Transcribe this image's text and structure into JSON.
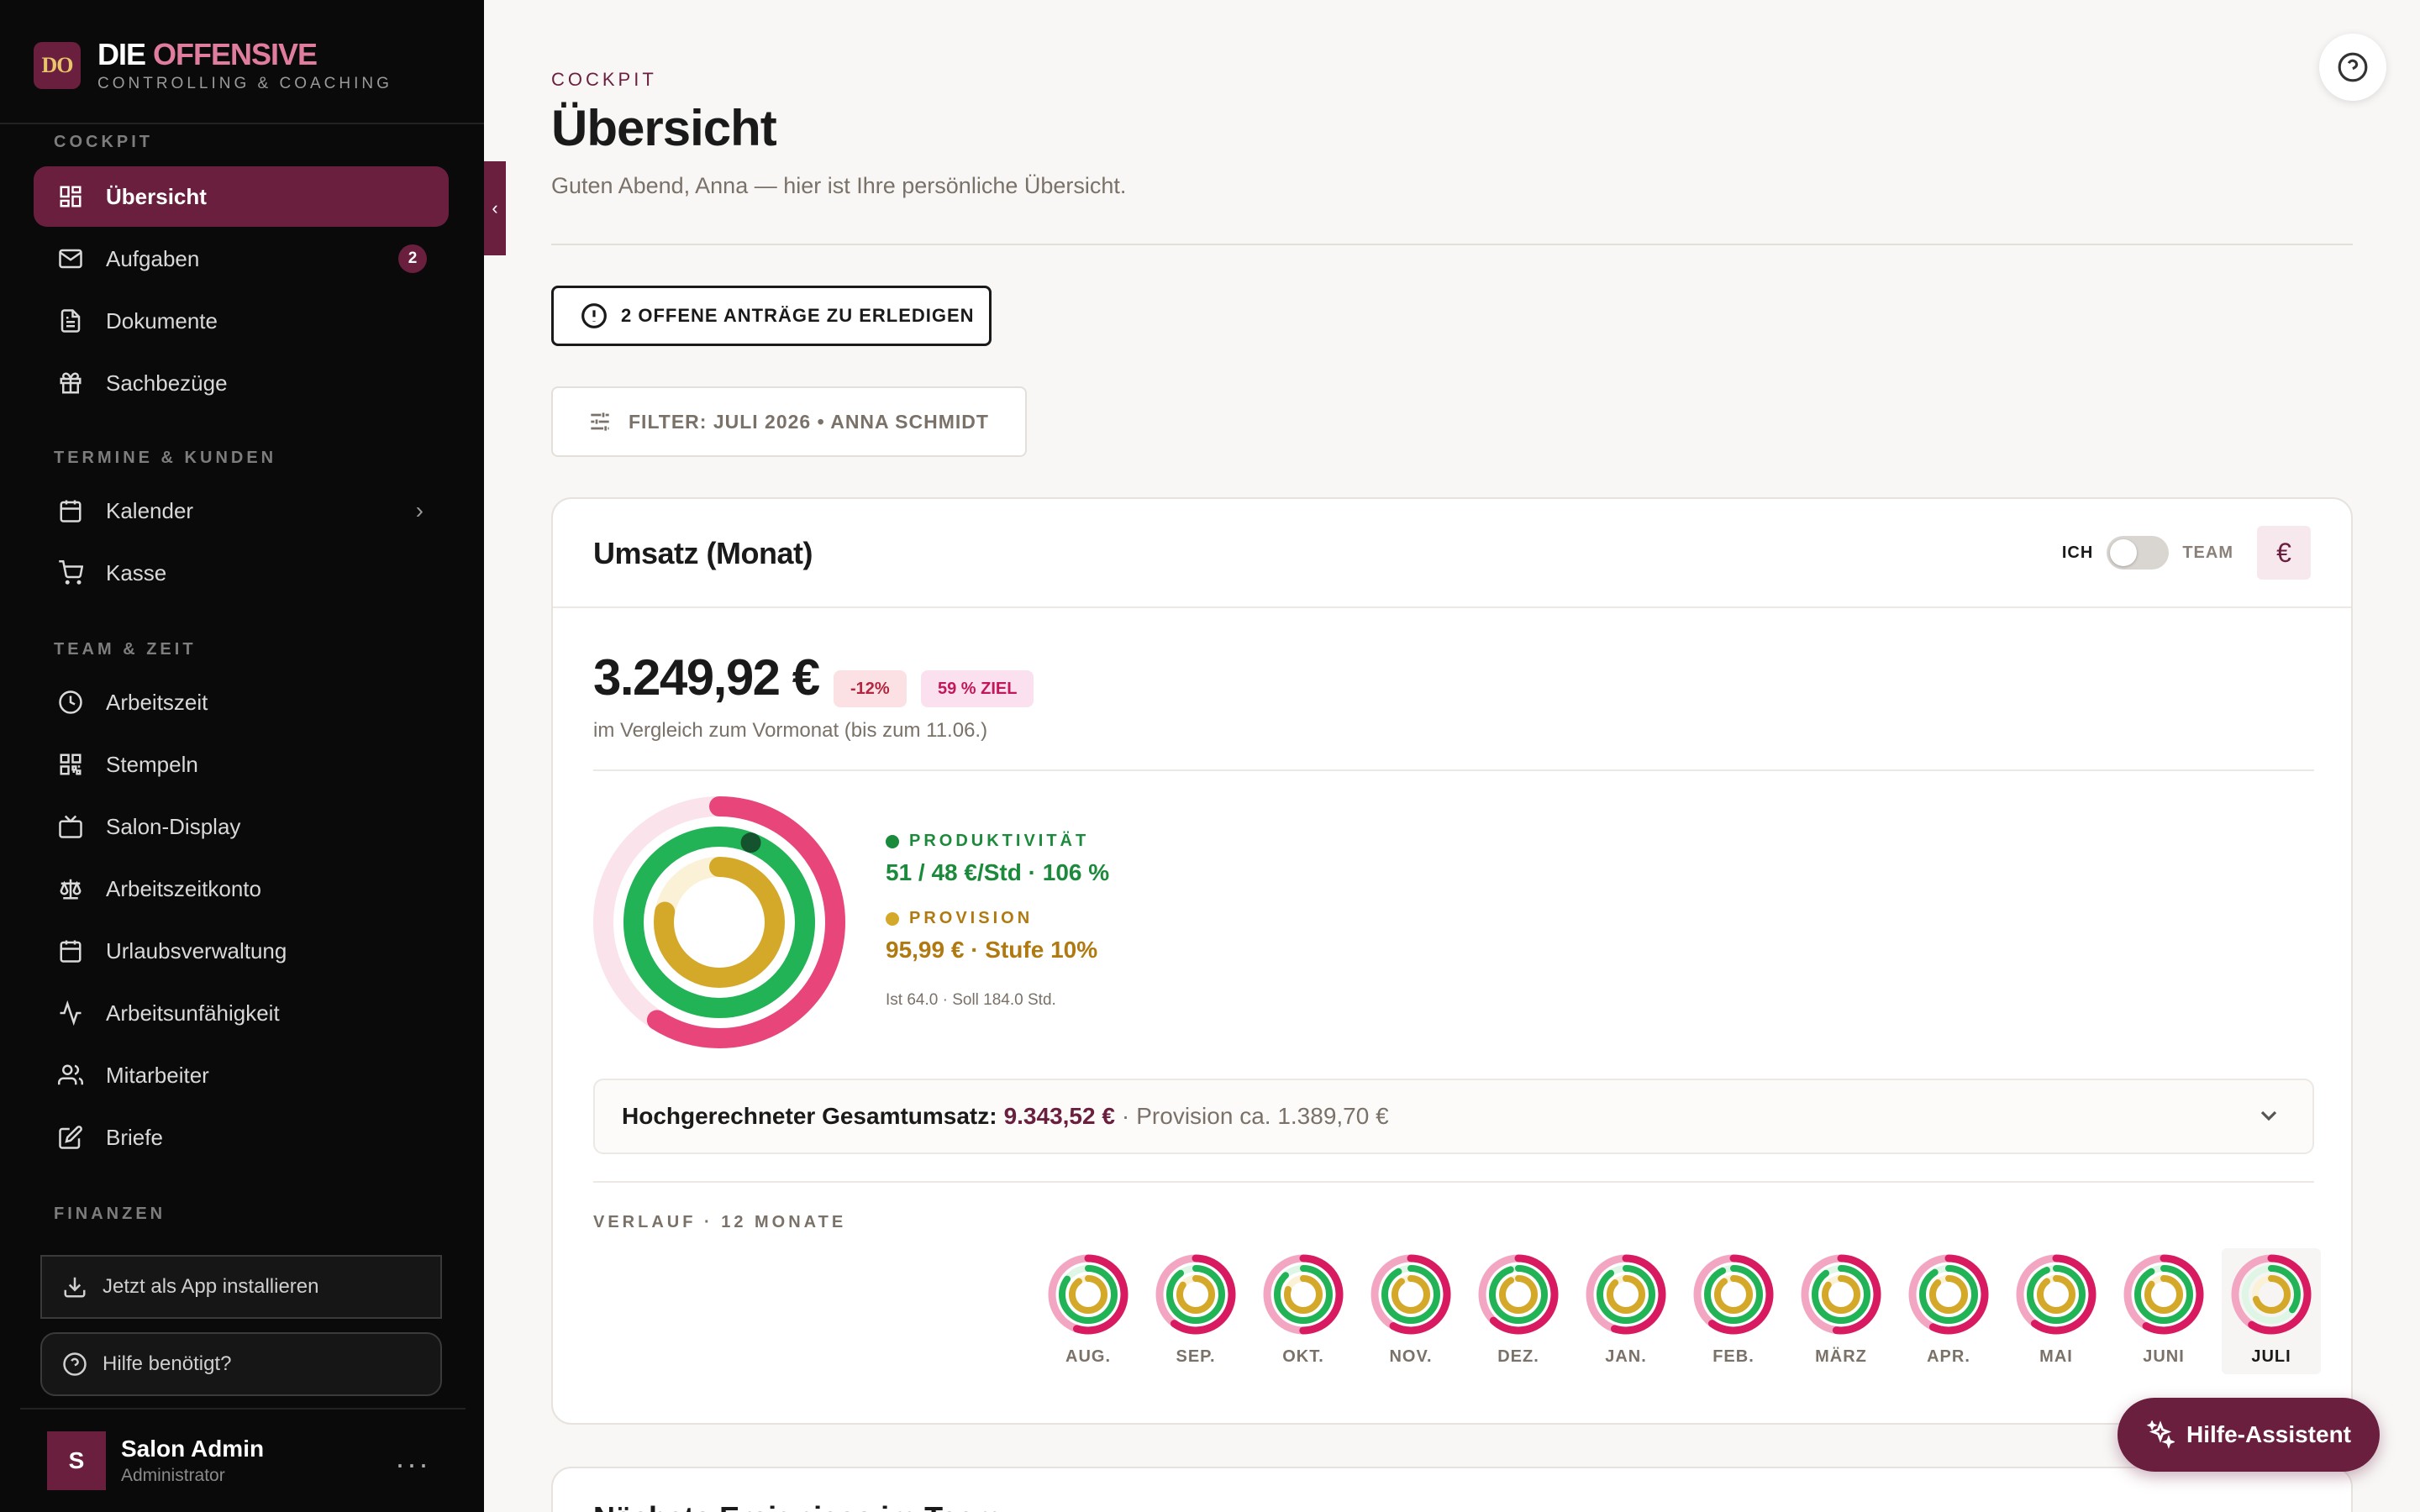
{
  "brand": {
    "logo_text": "DO",
    "title_part1": "DIE",
    "title_part2": "OFFENSIVE",
    "subtitle": "CONTROLLING & COACHING",
    "accent_color": "#6b1f3f"
  },
  "sidebar": {
    "sections": [
      {
        "label": "COCKPIT"
      },
      {
        "label": "TERMINE & KUNDEN"
      },
      {
        "label": "TEAM & ZEIT"
      },
      {
        "label": "FINANZEN"
      }
    ],
    "items": [
      {
        "label": "Übersicht",
        "icon": "dashboard-icon",
        "active": true
      },
      {
        "label": "Aufgaben",
        "icon": "mail-icon",
        "badge": "2"
      },
      {
        "label": "Dokumente",
        "icon": "document-icon"
      },
      {
        "label": "Sachbezüge",
        "icon": "gift-icon"
      },
      {
        "label": "Kalender",
        "icon": "calendar-icon",
        "expandable": true
      },
      {
        "label": "Kasse",
        "icon": "cart-icon"
      },
      {
        "label": "Arbeitszeit",
        "icon": "clock-icon"
      },
      {
        "label": "Stempeln",
        "icon": "qr-icon"
      },
      {
        "label": "Salon-Display",
        "icon": "tv-icon"
      },
      {
        "label": "Arbeitszeitkonto",
        "icon": "scale-icon"
      },
      {
        "label": "Urlaubsverwaltung",
        "icon": "calendar-icon"
      },
      {
        "label": "Arbeitsunfähigkeit",
        "icon": "activity-icon"
      },
      {
        "label": "Mitarbeiter",
        "icon": "users-icon"
      },
      {
        "label": "Briefe",
        "icon": "edit-icon"
      }
    ],
    "install_label": "Jetzt als App installieren",
    "help_label": "Hilfe benötigt?",
    "user": {
      "initial": "S",
      "name": "Salon Admin",
      "role": "Administrator"
    }
  },
  "header": {
    "eyebrow": "COCKPIT",
    "title": "Übersicht",
    "subtitle": "Guten Abend, Anna — hier ist Ihre persönliche Übersicht."
  },
  "pending": {
    "label": "2 OFFENE ANTRÄGE ZU ERLEDIGEN"
  },
  "filter": {
    "label": "FILTER: JULI 2026 • ANNA SCHMIDT"
  },
  "revenue_card": {
    "title": "Umsatz (Monat)",
    "toggle_left": "ICH",
    "toggle_right": "TEAM",
    "currency_symbol": "€",
    "amount": "3.249,92 €",
    "change": "-12%",
    "goal": "59 % ZIEL",
    "comparison": "im Vergleich zum Vormonat (bis zum 11.06.)",
    "productivity": {
      "label": "PRODUKTIVITÄT",
      "value": "51 / 48 €/Std · 106 %",
      "color": "#1b8a3a"
    },
    "commission": {
      "label": "PROVISION",
      "value": "95,99 € · Stufe 10%",
      "color": "#c99a1e"
    },
    "hours_note": "Ist 64.0 · Soll 184.0 Std.",
    "rings": {
      "revenue_goal_fraction": 0.59,
      "productivity_fraction": 1.06,
      "commission_fraction": 0.78
    },
    "forecast": {
      "label": "Hochgerechneter Gesamtumsatz:",
      "value": "9.343,52 €",
      "separator": "·",
      "commission": "Provision ca. 1.389,70 €"
    },
    "history_label": "VERLAUF · 12 MONATE",
    "months": [
      {
        "label": "AUG.",
        "revenue": 0.55,
        "productivity": 0.85,
        "commission": 0.9
      },
      {
        "label": "SEP.",
        "revenue": 0.6,
        "productivity": 0.9,
        "commission": 0.85
      },
      {
        "label": "OKT.",
        "revenue": 0.5,
        "productivity": 0.88,
        "commission": 0.8
      },
      {
        "label": "NOV.",
        "revenue": 0.58,
        "productivity": 0.92,
        "commission": 0.9
      },
      {
        "label": "DEZ.",
        "revenue": 0.62,
        "productivity": 0.95,
        "commission": 0.92
      },
      {
        "label": "JAN.",
        "revenue": 0.55,
        "productivity": 0.9,
        "commission": 0.88
      },
      {
        "label": "FEB.",
        "revenue": 0.6,
        "productivity": 0.93,
        "commission": 0.9
      },
      {
        "label": "MÄRZ",
        "revenue": 0.52,
        "productivity": 0.9,
        "commission": 0.85
      },
      {
        "label": "APR.",
        "revenue": 0.57,
        "productivity": 0.91,
        "commission": 0.88
      },
      {
        "label": "MAI",
        "revenue": 0.6,
        "productivity": 0.94,
        "commission": 0.9
      },
      {
        "label": "JUNI",
        "revenue": 0.58,
        "productivity": 0.92,
        "commission": 0.86
      },
      {
        "label": "JULI",
        "revenue": 0.59,
        "productivity": 0.35,
        "commission": 0.7,
        "current": true
      }
    ]
  },
  "next_card": {
    "title": "Nächste Ereignisse im Team"
  },
  "assistant": {
    "label": "Hilfe-Assistent"
  },
  "colors": {
    "pink": "#e8457a",
    "pink_light": "#fbe3ec",
    "green": "#22b357",
    "green_light": "#dff5e6",
    "gold": "#d4a92a",
    "gold_light": "#fbf1d6"
  }
}
